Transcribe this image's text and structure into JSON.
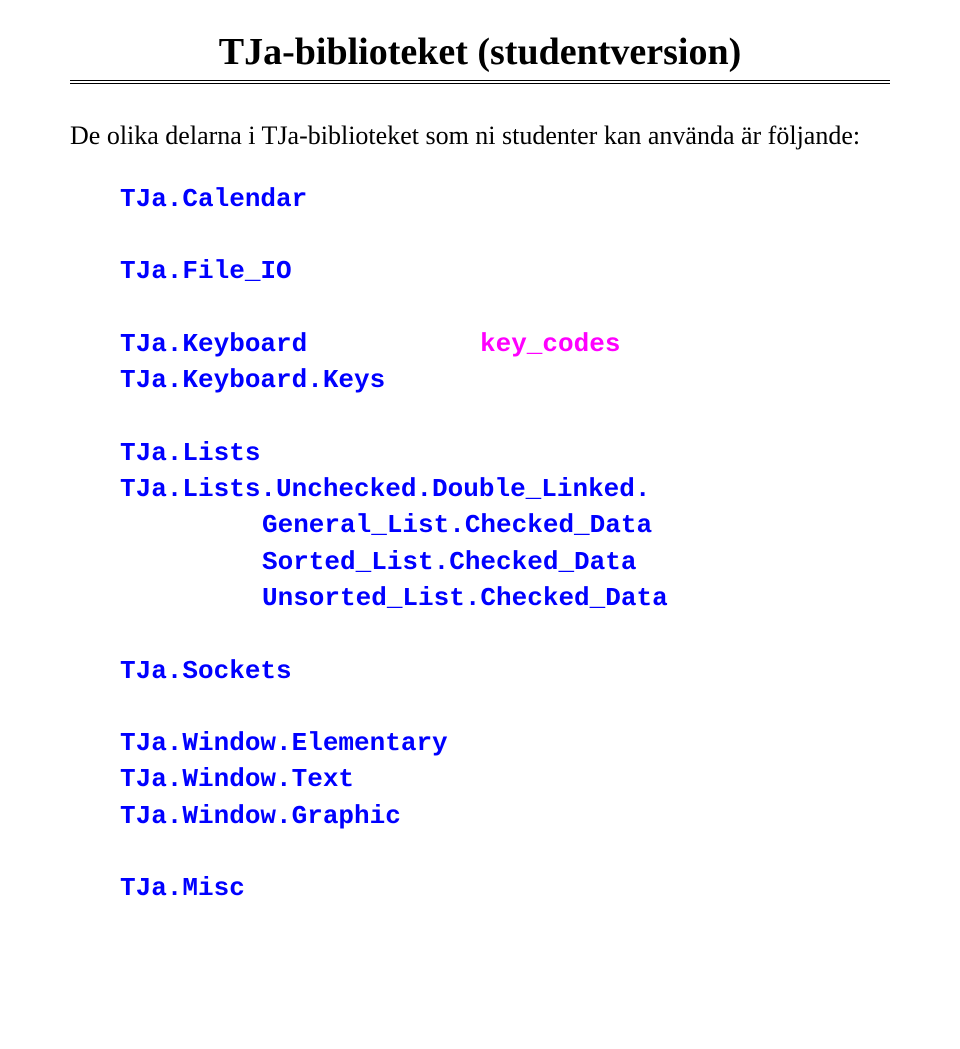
{
  "title": "TJa-biblioteket (studentversion)",
  "intro": "De olika delarna i TJa-biblioteket som ni studenter kan använda är följande:",
  "lines": {
    "calendar": "TJa.Calendar",
    "file_io": "TJa.File_IO",
    "keyboard": "TJa.Keyboard",
    "key_codes": "key_codes",
    "keyboard_keys": "TJa.Keyboard.Keys",
    "lists": "TJa.Lists",
    "lists_unchecked": "TJa.Lists.Unchecked.Double_Linked.",
    "general_list": "General_List.Checked_Data",
    "sorted_list": "Sorted_List.Checked_Data",
    "unsorted_list": "Unsorted_List.Checked_Data",
    "sockets": "TJa.Sockets",
    "window_elementary": "TJa.Window.Elementary",
    "window_text": "TJa.Window.Text",
    "window_graphic": "TJa.Window.Graphic",
    "misc": "TJa.Misc"
  }
}
